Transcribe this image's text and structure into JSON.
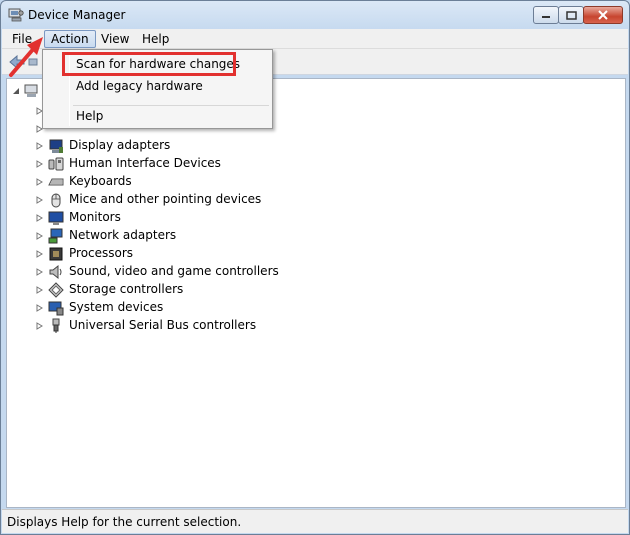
{
  "window": {
    "title": "Device Manager"
  },
  "menubar": {
    "items": [
      {
        "label": "File"
      },
      {
        "label": "Action"
      },
      {
        "label": "View"
      },
      {
        "label": "Help"
      }
    ]
  },
  "action_menu": {
    "items": [
      {
        "label": "Scan for hardware changes",
        "icon": "none"
      },
      {
        "label": "Add legacy hardware",
        "icon": "none"
      },
      {
        "label": "Help",
        "icon": "none"
      }
    ]
  },
  "tree": {
    "items": [
      {
        "label": "Display adapters",
        "icon": "display-adapter-icon"
      },
      {
        "label": "Human Interface Devices",
        "icon": "hid-icon"
      },
      {
        "label": "Keyboards",
        "icon": "keyboard-icon"
      },
      {
        "label": "Mice and other pointing devices",
        "icon": "mouse-icon"
      },
      {
        "label": "Monitors",
        "icon": "monitor-icon"
      },
      {
        "label": "Network adapters",
        "icon": "network-adapter-icon"
      },
      {
        "label": "Processors",
        "icon": "processor-icon"
      },
      {
        "label": "Sound, video and game controllers",
        "icon": "sound-icon"
      },
      {
        "label": "Storage controllers",
        "icon": "storage-icon"
      },
      {
        "label": "System devices",
        "icon": "system-devices-icon"
      },
      {
        "label": "Universal Serial Bus controllers",
        "icon": "usb-icon"
      }
    ]
  },
  "statusbar": {
    "text": "Displays Help for the current selection."
  },
  "colors": {
    "highlight": "#e2312f",
    "menu_active": "#c9dbf0"
  }
}
